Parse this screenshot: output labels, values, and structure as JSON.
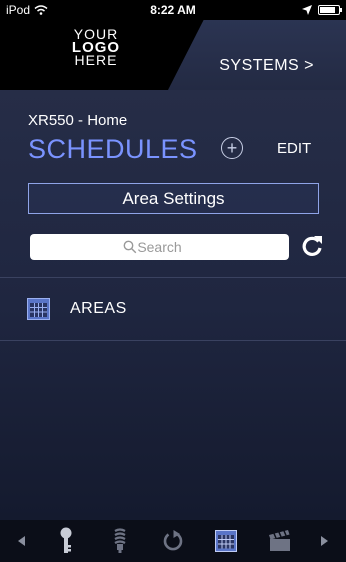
{
  "status_bar": {
    "carrier": "iPod",
    "time": "8:22 AM",
    "battery_level": 0.85
  },
  "header": {
    "logo": [
      "YOUR",
      "LOGO",
      "HERE"
    ],
    "systems_label": "SYSTEMS >"
  },
  "main": {
    "system_name": "XR550 - Home",
    "title": "SCHEDULES",
    "add_label": "+",
    "edit_label": "EDIT",
    "area_settings_label": "Area Settings",
    "search_placeholder": "Search",
    "items": [
      {
        "label": "AREAS",
        "icon": "calendar-icon"
      }
    ]
  },
  "tab_bar": {
    "tabs": [
      "key-icon",
      "lightbulb-icon",
      "power-icon",
      "calendar-icon",
      "clapperboard-icon"
    ],
    "active": "calendar-icon"
  },
  "colors": {
    "accent": "#7a93ff",
    "border": "#8fa4e8",
    "background": "#1f2640"
  }
}
